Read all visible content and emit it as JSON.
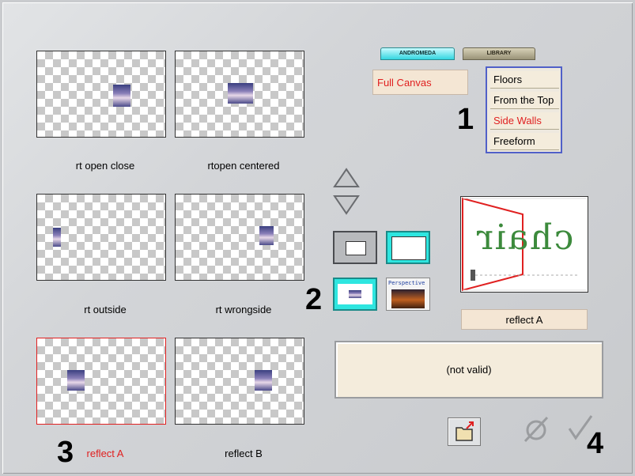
{
  "tabs": [
    {
      "label": "ANDROMEDA",
      "active": true
    },
    {
      "label": "LIBRARY",
      "active": false
    }
  ],
  "effect_panel": {
    "full_canvas_label": "Full Canvas",
    "menu_items": [
      {
        "label": "Floors",
        "active": false
      },
      {
        "label": "From the Top",
        "active": false
      },
      {
        "label": "Side Walls",
        "active": true
      },
      {
        "label": "Freeform",
        "active": false
      }
    ]
  },
  "presets": [
    {
      "label": "rt open close",
      "selected": false
    },
    {
      "label": "rtopen centered",
      "selected": false
    },
    {
      "label": "rt outside",
      "selected": false
    },
    {
      "label": "rt wrongside",
      "selected": false
    },
    {
      "label": "reflect A",
      "selected": true
    },
    {
      "label": "reflect B",
      "selected": false
    }
  ],
  "frame_buttons": {
    "perspective_label": "Perspective"
  },
  "preview": {
    "text": "chair",
    "name": "reflect A"
  },
  "status": {
    "text": "(not valid)"
  },
  "markers": {
    "m1": "1",
    "m2": "2",
    "m3": "3",
    "m4": "4"
  },
  "colors": {
    "accent_red": "#e02020",
    "menu_border": "#5060c8",
    "cyan_highlight": "#2ee6e0"
  }
}
